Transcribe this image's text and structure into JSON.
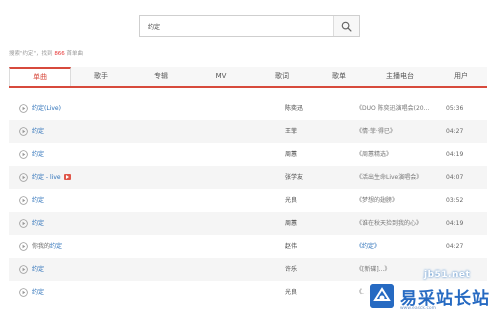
{
  "search": {
    "value": "约定",
    "button_icon": "search-icon"
  },
  "summary": {
    "prefix": "搜索\"约定\"，找到 ",
    "count": "866",
    "suffix": " 首单曲"
  },
  "tabs": [
    {
      "label": "单曲",
      "active": true
    },
    {
      "label": "歌手"
    },
    {
      "label": "专辑"
    },
    {
      "label": "MV"
    },
    {
      "label": "歌词"
    },
    {
      "label": "歌单"
    },
    {
      "label": "主播电台"
    },
    {
      "label": "用户"
    }
  ],
  "songs": [
    {
      "title": "约定(Live)",
      "singer": "陈奕迅",
      "album": "《DUO 陈奕迅演唱会(20...",
      "time": "05:36"
    },
    {
      "title": "约定",
      "singer": "王菲",
      "album": "《情·菲·得已》",
      "time": "04:27"
    },
    {
      "title": "约定",
      "singer": "周蕙",
      "album": "《周蕙精选》",
      "time": "04:19"
    },
    {
      "title": "约定 - live",
      "singer": "张学友",
      "album": "《活出生命Live演唱会》",
      "time": "04:07",
      "has_mv": true
    },
    {
      "title": "约定",
      "singer": "光良",
      "album": "《梦想的翅膀》",
      "time": "03:52"
    },
    {
      "title": "约定",
      "singer": "周蕙",
      "album": "《谁在秋天捡到我的心》",
      "time": "04:19"
    },
    {
      "title_prefix": "你我的",
      "title": "约定",
      "singer": "赵伟",
      "album": "《约定》",
      "time": "04:27",
      "album_link": true
    },
    {
      "title": "约定",
      "singer": "许乐",
      "album": "《[新碟]...》",
      "time": ""
    },
    {
      "title": "约定",
      "singer": "光良",
      "album": "《...》",
      "time": ""
    }
  ],
  "watermark": {
    "url": "jb51.net",
    "title": "易采站长站",
    "subtitle": "www.easck.com"
  }
}
